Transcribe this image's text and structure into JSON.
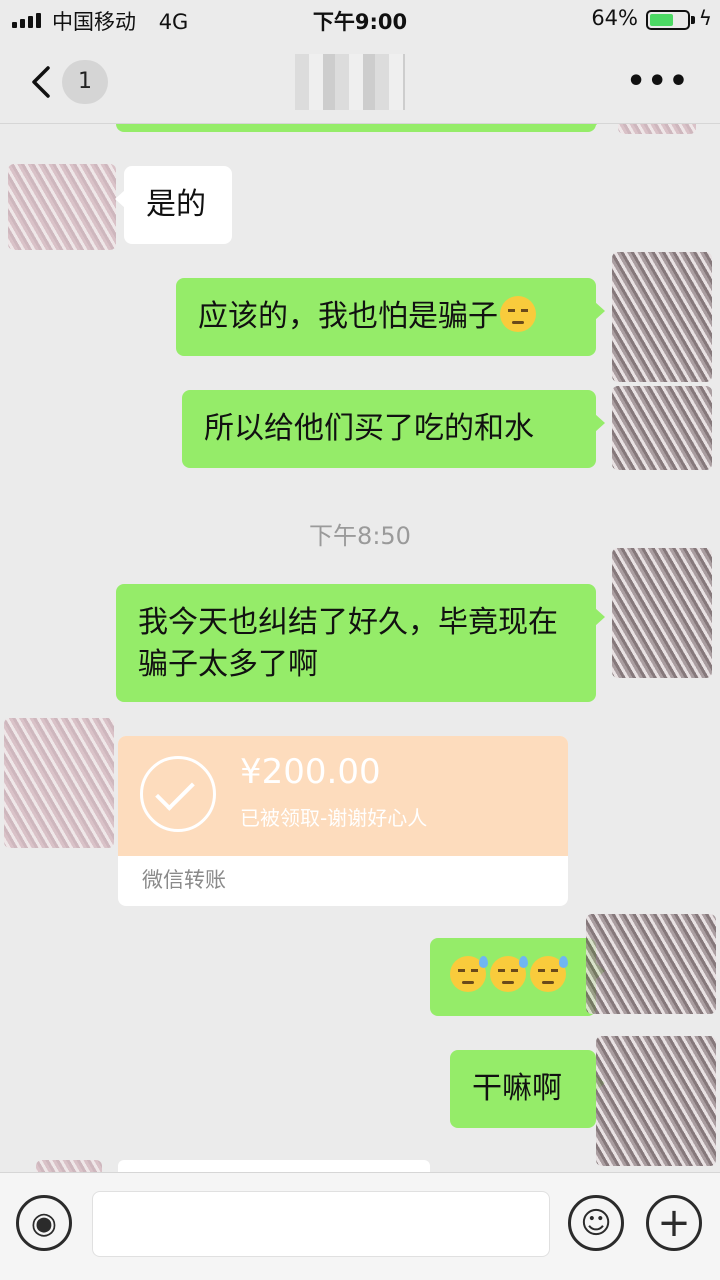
{
  "status_bar": {
    "carrier": "中国移动",
    "network": "4G",
    "time": "下午9:00",
    "battery_percent": "64%",
    "battery_level": 0.64,
    "charging_icon": "ϟ"
  },
  "nav": {
    "unread_count": "1",
    "more_label": "•••"
  },
  "messages": {
    "m1": "是的",
    "m2": "应该的，我也怕是骗子",
    "m3": "所以给他们买了吃的和水",
    "time_divider": "下午8:50",
    "m4": "我今天也纠结了好久，毕竟现在骗子太多了啊",
    "transfer": {
      "amount": "¥200.00",
      "note": "已被领取-谢谢好心人",
      "footer": "微信转账"
    },
    "m6_emoji_count": 3,
    "m7": "干嘛啊"
  },
  "input_bar": {
    "voice_icon": "voice-icon",
    "emoji_icon": "smile-icon",
    "plus_icon": "plus-icon",
    "plus_glyph": "+",
    "emoji_glyph": "☺",
    "voice_glyph": "◉",
    "input_value": ""
  },
  "colors": {
    "outgoing_bubble": "#95ec69",
    "incoming_bubble": "#ffffff",
    "background": "#ebebeb",
    "transfer_card": "#fddcbd"
  }
}
